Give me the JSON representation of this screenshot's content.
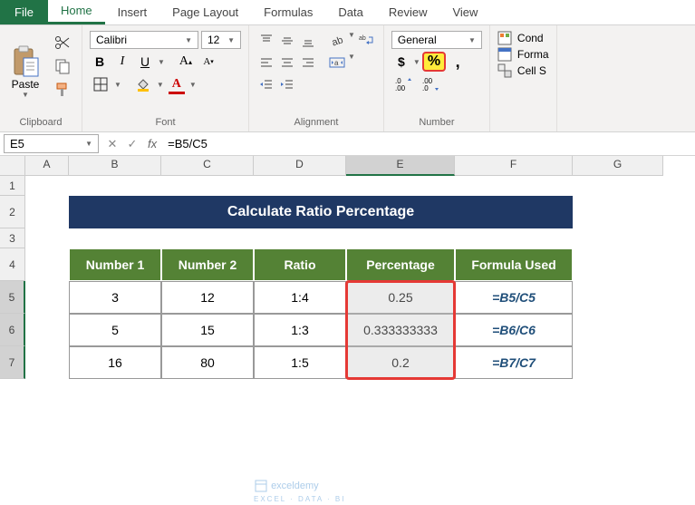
{
  "tabs": {
    "file": "File",
    "home": "Home",
    "insert": "Insert",
    "layout": "Page Layout",
    "formulas": "Formulas",
    "data": "Data",
    "review": "Review",
    "view": "View"
  },
  "ribbon": {
    "clipboard": {
      "label": "Clipboard",
      "paste": "Paste"
    },
    "font": {
      "label": "Font",
      "name": "Calibri",
      "size": "12",
      "bold": "B",
      "italic": "I",
      "underline": "U"
    },
    "alignment": {
      "label": "Alignment"
    },
    "number": {
      "label": "Number",
      "format": "General",
      "currency": "$",
      "percent": "%",
      "comma": ","
    },
    "styles": {
      "cond": "Cond",
      "format": "Forma",
      "cell": "Cell S"
    }
  },
  "namebox": "E5",
  "formula": "=B5/C5",
  "columns": [
    "A",
    "B",
    "C",
    "D",
    "E",
    "F",
    "G"
  ],
  "rows": [
    "1",
    "2",
    "3",
    "4",
    "5",
    "6",
    "7"
  ],
  "table": {
    "title": "Calculate Ratio Percentage",
    "headers": [
      "Number 1",
      "Number 2",
      "Ratio",
      "Percentage",
      "Formula Used"
    ],
    "data": [
      {
        "n1": "3",
        "n2": "12",
        "ratio": "1:4",
        "pct": "0.25",
        "formula": "=B5/C5"
      },
      {
        "n1": "5",
        "n2": "15",
        "ratio": "1:3",
        "pct": "0.333333333",
        "formula": "=B6/C6"
      },
      {
        "n1": "16",
        "n2": "80",
        "ratio": "1:5",
        "pct": "0.2",
        "formula": "=B7/C7"
      }
    ]
  },
  "watermark": {
    "main": "exceldemy",
    "sub": "EXCEL · DATA · BI"
  },
  "chart_data": {
    "type": "table",
    "title": "Calculate Ratio Percentage",
    "columns": [
      "Number 1",
      "Number 2",
      "Ratio",
      "Percentage",
      "Formula Used"
    ],
    "rows": [
      [
        3,
        12,
        "1:4",
        0.25,
        "=B5/C5"
      ],
      [
        5,
        15,
        "1:3",
        0.333333333,
        "=B6/C6"
      ],
      [
        16,
        80,
        "1:5",
        0.2,
        "=B7/C7"
      ]
    ]
  }
}
